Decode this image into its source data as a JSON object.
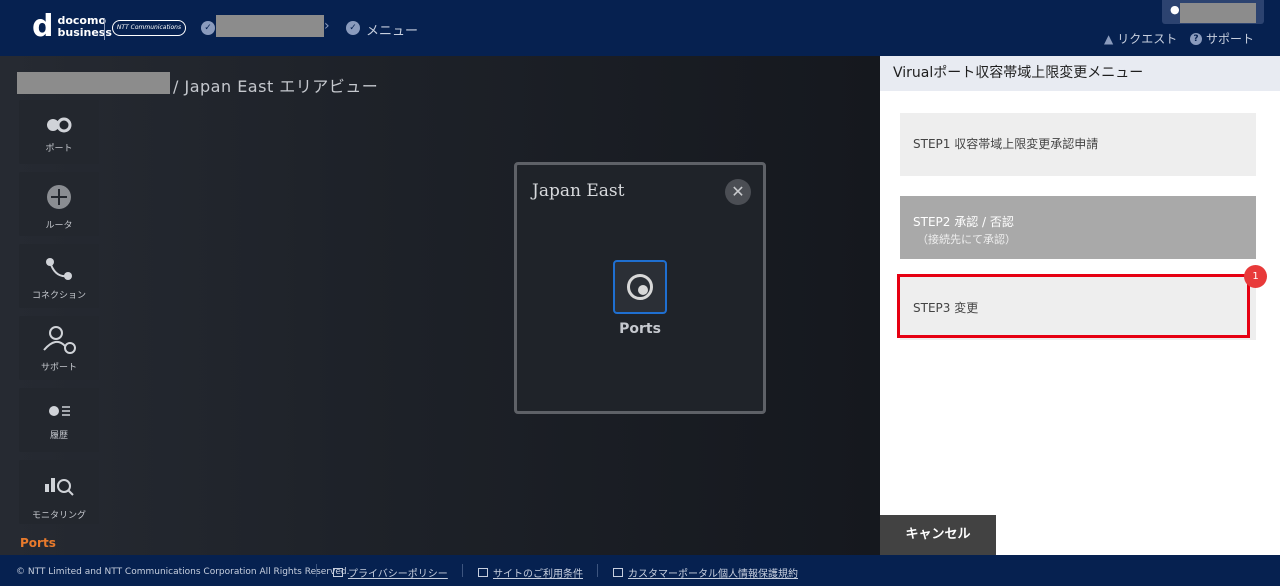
{
  "header": {
    "logo_line1": "docomo",
    "logo_line2": "business",
    "logo_ntt": "NTT Communications",
    "breadcrumb_menu": "メニュー",
    "request_label": "リクエスト",
    "support_label": "サポート"
  },
  "page": {
    "title": "/ Japan East エリアビュー"
  },
  "sidebar": {
    "items": [
      {
        "label": "ポート",
        "icon": "port-icon"
      },
      {
        "label": "ルータ",
        "icon": "router-icon"
      },
      {
        "label": "コネクション",
        "icon": "connection-icon"
      },
      {
        "label": "サポート",
        "icon": "support-icon"
      },
      {
        "label": "履歴",
        "icon": "history-icon"
      },
      {
        "label": "モニタリング",
        "icon": "monitoring-icon"
      }
    ],
    "ports_link": "Ports"
  },
  "modal": {
    "title": "Japan East",
    "ports_label": "Ports"
  },
  "panel": {
    "title": "Virualポート収容帯域上限変更メニュー",
    "step1": "STEP1 収容帯域上限変更承認申請",
    "step2_title": "STEP2 承認 / 否認",
    "step2_sub": "（接続先にて承認）",
    "step3": "STEP3 変更",
    "badge": "1",
    "cancel": "キャンセル"
  },
  "footer": {
    "copyright": "© NTT Limited and NTT Communications Corporation All Rights Reserved.",
    "links": [
      "プライバシーポリシー",
      "サイトのご利用条件",
      "カスタマーポータル個人情報保護規約"
    ]
  },
  "colors": {
    "header_bg": "#062150",
    "highlight": "#e60012",
    "accent_orange": "#e87a2c",
    "accent_blue": "#1f6fd0"
  }
}
